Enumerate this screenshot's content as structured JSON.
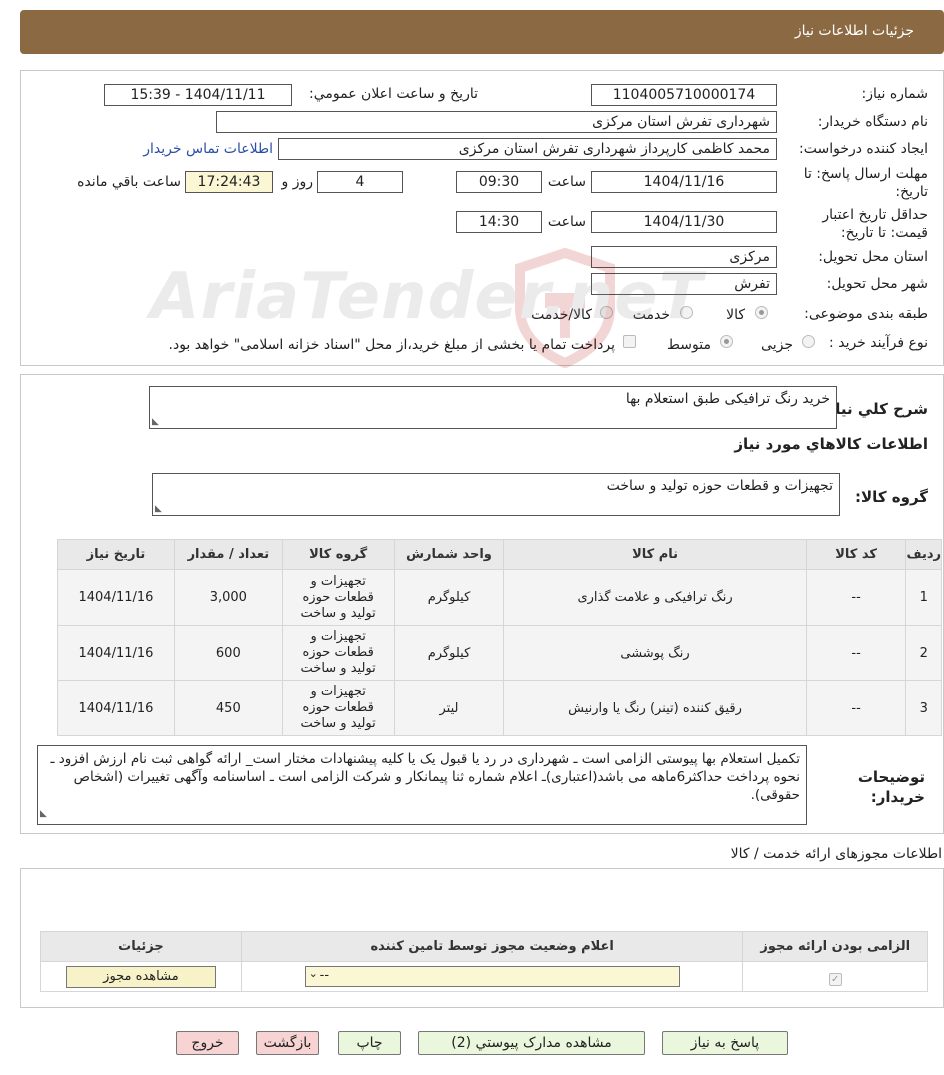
{
  "header": {
    "title": "جزئیات اطلاعات نیاز"
  },
  "form": {
    "need_number_label": "شماره نیاز:",
    "need_number": "1104005710000174",
    "announce_label": "تاریخ و ساعت اعلان عمومي:",
    "announce_value": "1404/11/11 - 15:39",
    "buyer_org_label": "نام دستگاه خريدار:",
    "buyer_org": "شهرداری تفرش استان مرکزی",
    "requester_label": "ايجاد کننده درخواست:",
    "requester": "محمد کاظمی کارپرداز شهرداری تفرش استان مرکزی",
    "contact_link": "اطلاعات تماس خريدار",
    "deadline_label": "مهلت ارسال پاسخ: تا تاریخ:",
    "deadline_date": "1404/11/16",
    "time_label": "ساعت",
    "deadline_time": "09:30",
    "days_value": "4",
    "days_label": "روز و",
    "remaining_time": "17:24:43",
    "remaining_label": "ساعت باقي مانده",
    "validity_label": "حداقل تاریخ اعتبار قیمت: تا تاریخ:",
    "validity_date": "1404/11/30",
    "validity_time_label": "ساعت",
    "validity_time": "14:30",
    "province_label": "استان محل تحويل:",
    "province": "مرکزی",
    "city_label": "شهر محل تحويل:",
    "city": "تفرش",
    "category_label": "طبقه بندی موضوعی:",
    "category_options": [
      "کالا",
      "خدمت",
      "کالا/خدمت"
    ],
    "process_label": "نوع فرآیند خرید :",
    "process_options": [
      "جزیی",
      "متوسط"
    ],
    "treasury_note": "پرداخت تمام یا بخشی از مبلغ خرید،از محل \"اسناد خزانه اسلامی\" خواهد بود."
  },
  "summary": {
    "label": "شرح کلي نياز:",
    "value": "خرید رنگ ترافیکی طبق استعلام بها",
    "goods_info_title": "اطلاعات کالاهاي مورد نياز",
    "group_label": "گروه کالا:",
    "group_value": "تجهیزات و قطعات حوزه تولید و ساخت"
  },
  "goods_table": {
    "headers": [
      "رديف",
      "کد کالا",
      "نام کالا",
      "واحد شمارش",
      "گروه کالا",
      "تعداد / مقدار",
      "تاریخ نیاز"
    ],
    "rows": [
      {
        "row": "1",
        "code": "--",
        "name": "رنگ ترافیکی و علامت گذاری",
        "unit": "کیلوگرم",
        "group": "تجهیزات و قطعات حوزه تولید و ساخت",
        "qty": "3,000",
        "date": "1404/11/16"
      },
      {
        "row": "2",
        "code": "--",
        "name": "رنگ پوششی",
        "unit": "کیلوگرم",
        "group": "تجهیزات و قطعات حوزه تولید و ساخت",
        "qty": "600",
        "date": "1404/11/16"
      },
      {
        "row": "3",
        "code": "--",
        "name": "رقیق کننده (تینر) رنگ یا وارنیش",
        "unit": "لیتر",
        "group": "تجهیزات و قطعات حوزه تولید و ساخت",
        "qty": "450",
        "date": "1404/11/16"
      }
    ]
  },
  "buyer_notes": {
    "label": "توضيحات خريدار:",
    "text": "تکمیل استعلام بها پیوستی الزامی است ـ شهرداری در رد یا قبول یک یا کلیه پیشنهادات مختار است_ ارائه گواهی ثبت نام ارزش افزود ـ نحوه پرداخت حداکثر6ماهه می باشد(اعتباری)ـ اعلام شماره ثنا پیمانکار و شرکت الزامی است ـ اساسنامه وآگهی تغییرات (اشخاص حقوقی)."
  },
  "permits": {
    "title": "اطلاعات مجوزهای ارائه خدمت / کالا",
    "headers": [
      "الزامی بودن ارائه مجوز",
      "اعلام وضعیت مجوز توسط تامین کننده",
      "جزئیات"
    ],
    "select_value": "--",
    "view_button": "مشاهده مجوز"
  },
  "actions": {
    "reply": "پاسخ به نياز",
    "attachments": "مشاهده مدارک پيوستي (2)",
    "print": "چاپ",
    "back": "بازگشت",
    "exit": "خروج"
  },
  "watermark": {
    "text": "AriaTender.neT"
  }
}
